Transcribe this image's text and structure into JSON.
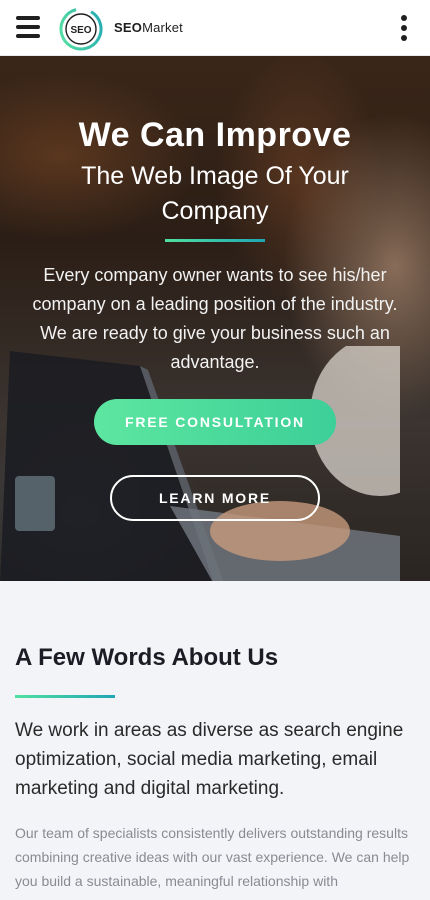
{
  "header": {
    "logo_badge": "SEO",
    "brand_bold": "SEO",
    "brand_rest": "Market",
    "icons": {
      "menu": "hamburger-icon",
      "more": "kebab-icon"
    }
  },
  "hero": {
    "title_line1": "We Can Improve",
    "title_line2": "The Web Image Of Your Company",
    "description": "Every company owner wants to see his/her company on a leading position of the industry. We are ready to give your business such an advantage.",
    "primary_button": "FREE CONSULTATION",
    "secondary_button": "LEARN MORE"
  },
  "about": {
    "title": "A Few Words About Us",
    "lead": "We work in areas as diverse as search engine optimization, social media marketing, email marketing and digital marketing.",
    "text": "Our team of specialists consistently delivers outstanding results combining creative ideas with our vast experience. We can help you build a sustainable, meaningful relationship with"
  },
  "colors": {
    "accent_start": "#5de6a0",
    "accent_end": "#1fa6b4",
    "header_bg": "#ffffff",
    "section_bg": "#f3f4f8"
  }
}
